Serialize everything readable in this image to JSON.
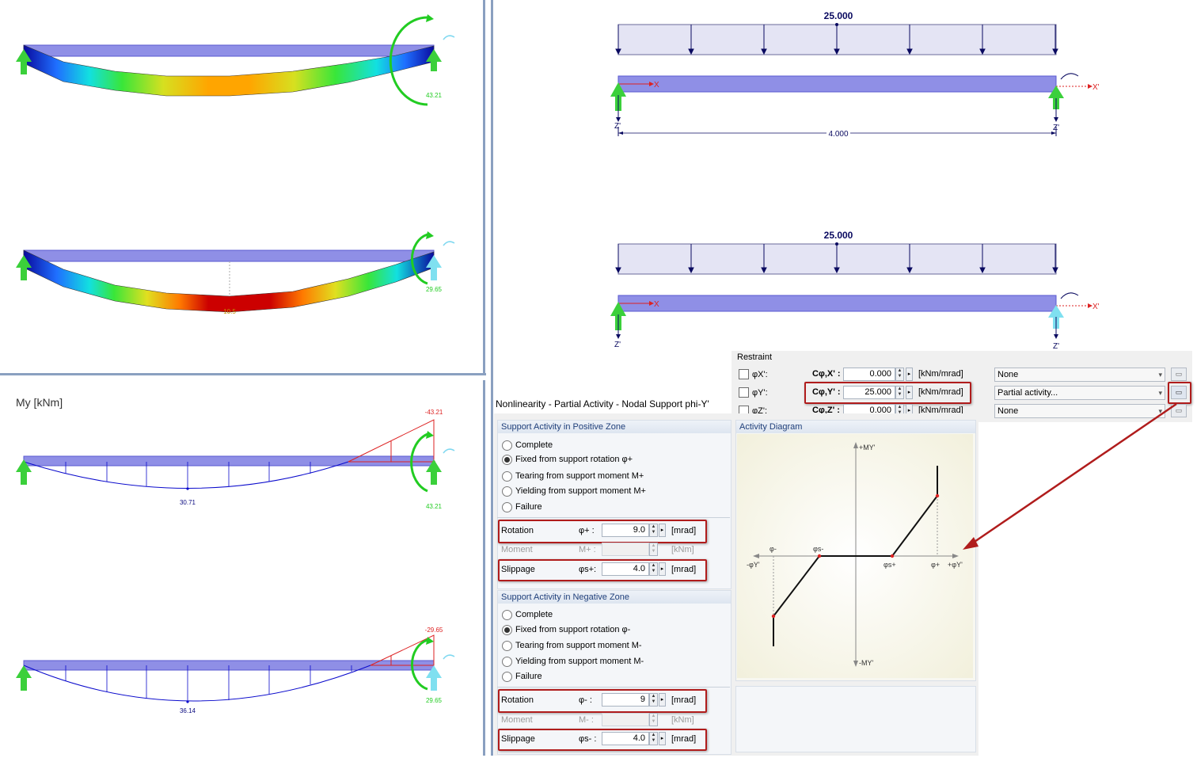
{
  "left_top": {
    "beam1": {
      "reaction_value": "43.21"
    },
    "beam2": {
      "reaction_value": "29.65",
      "mid_label": "10.5"
    }
  },
  "left_bottom": {
    "result_label": "My [kNm]",
    "diagram1": {
      "end_moment": "-43.21",
      "mid_moment": "30.71",
      "reaction_value": "43.21"
    },
    "diagram2": {
      "end_moment": "-29.65",
      "mid_moment": "36.14",
      "reaction_value": "29.65"
    }
  },
  "right_top": {
    "model1": {
      "load_value": "25.000",
      "length": "4.000",
      "x_label": "X",
      "x_prime_label": "X'",
      "z_label": "Z'",
      "z_end_label": "Z'"
    },
    "model2": {
      "load_value": "25.000",
      "x_label": "X",
      "x_prime_label": "X'",
      "z_label": "Z'",
      "z_end_label": "Z'"
    }
  },
  "restraint": {
    "title": "Restraint",
    "rows": [
      {
        "phi": "φX':",
        "c_label": "Cφ,X' :",
        "value": "0.000",
        "unit": "[kNm/mrad]",
        "combo": "None"
      },
      {
        "phi": "φY':",
        "c_label": "Cφ,Y' :",
        "value": "25.000",
        "unit": "[kNm/mrad]",
        "combo": "Partial activity..."
      },
      {
        "phi": "φZ':",
        "c_label": "Cφ,Z' :",
        "value": "0.000",
        "unit": "[kNm/mrad]",
        "combo": "None"
      }
    ]
  },
  "dialog": {
    "title": "Nonlinearity - Partial Activity - Nodal Support phi-Y'",
    "positive": {
      "title": "Support Activity in Positive Zone",
      "options": [
        "Complete",
        "Fixed from support rotation φ+",
        "Tearing from support moment M+",
        "Yielding from support moment M+",
        "Failure"
      ],
      "selected": 1,
      "rotation": {
        "label": "Rotation",
        "symbol": "φ+ :",
        "value": "9.0",
        "unit": "[mrad]"
      },
      "moment": {
        "label": "Moment",
        "symbol": "M+ :",
        "value": "",
        "unit": "[kNm]"
      },
      "slippage": {
        "label": "Slippage",
        "symbol": "φs+:",
        "value": "4.0",
        "unit": "[mrad]"
      }
    },
    "negative": {
      "title": "Support Activity in Negative Zone",
      "options": [
        "Complete",
        "Fixed from support rotation φ-",
        "Tearing from support moment M-",
        "Yielding from support moment M-",
        "Failure"
      ],
      "selected": 1,
      "rotation": {
        "label": "Rotation",
        "symbol": "φ- :",
        "value": "9",
        "unit": "[mrad]"
      },
      "moment": {
        "label": "Moment",
        "symbol": "M- :",
        "value": "",
        "unit": "[kNm]"
      },
      "slippage": {
        "label": "Slippage",
        "symbol": "φs- :",
        "value": "4.0",
        "unit": "[mrad]"
      }
    },
    "diagram": {
      "title": "Activity Diagram",
      "labels": {
        "m_pos": "+MY'",
        "m_neg": "-MY'",
        "phi_neg": "-φY'",
        "phi_pos": "+φY'",
        "phi_minus": "φ-",
        "phi_s_minus": "φs-",
        "phi_s_plus": "φs+",
        "phi_plus": "φ+"
      }
    }
  },
  "colors": {
    "highlight": "#b01c1c",
    "beam": "#8f8fe6",
    "support_green": "#3bd03b",
    "support_cyan": "#7fe0f0",
    "load": "#e4e4f4"
  }
}
